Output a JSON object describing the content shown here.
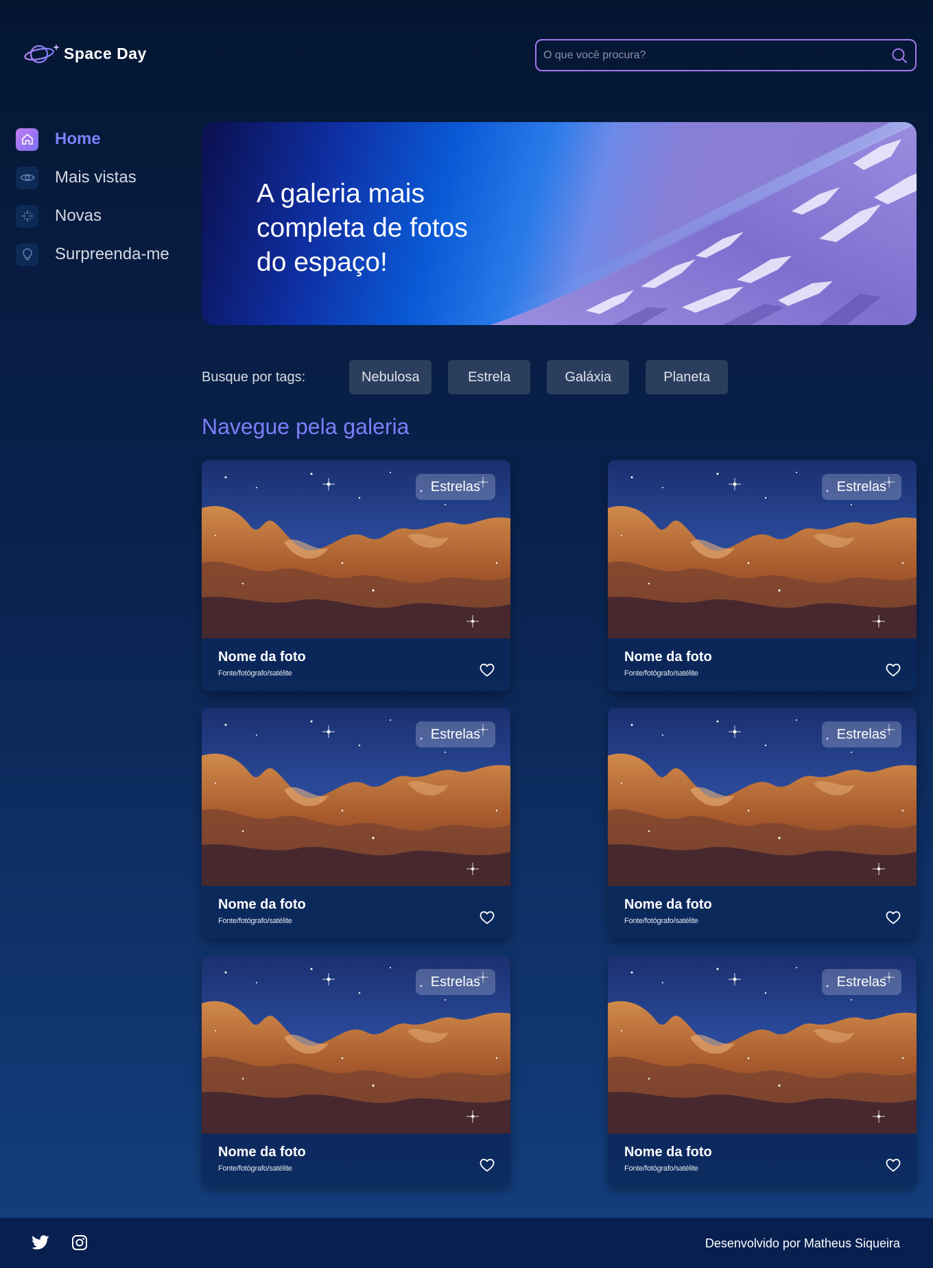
{
  "app": {
    "logo_text": "Space Day"
  },
  "search": {
    "placeholder": "O que você procura?"
  },
  "sidebar": {
    "items": [
      {
        "label": "Home",
        "icon": "home-icon",
        "active": true
      },
      {
        "label": "Mais vistas",
        "icon": "eye-icon",
        "active": false
      },
      {
        "label": "Novas",
        "icon": "sparkle-icon",
        "active": false
      },
      {
        "label": "Surpreenda-me",
        "icon": "lightbulb-icon",
        "active": false
      }
    ]
  },
  "banner": {
    "title": "A galeria mais completa de fotos do espaço!"
  },
  "tags": {
    "label": "Busque por tags:",
    "items": [
      "Nebulosa",
      "Estrela",
      "Galáxia",
      "Planeta"
    ]
  },
  "gallery": {
    "title": "Navegue pela galeria",
    "cards": [
      {
        "badge": "Estrelas",
        "title": "Nome da foto",
        "source": "Fonte/fotógrafo/satélite"
      },
      {
        "badge": "Estrelas",
        "title": "Nome da foto",
        "source": "Fonte/fotógrafo/satélite"
      },
      {
        "badge": "Estrelas",
        "title": "Nome da foto",
        "source": "Fonte/fotógrafo/satélite"
      },
      {
        "badge": "Estrelas",
        "title": "Nome da foto",
        "source": "Fonte/fotógrafo/satélite"
      },
      {
        "badge": "Estrelas",
        "title": "Nome da foto",
        "source": "Fonte/fotógrafo/satélite"
      },
      {
        "badge": "Estrelas",
        "title": "Nome da foto",
        "source": "Fonte/fotógrafo/satélite"
      }
    ]
  },
  "footer": {
    "social": [
      "twitter-icon",
      "instagram-icon"
    ],
    "credit": "Desenvolvido por Matheus Siqueira"
  },
  "colors": {
    "accent": "#7b7ff8",
    "search_border": "#a578ef",
    "tag_bg": "#2c3e5e",
    "background_top": "#041632",
    "background_bottom": "#14407f"
  }
}
